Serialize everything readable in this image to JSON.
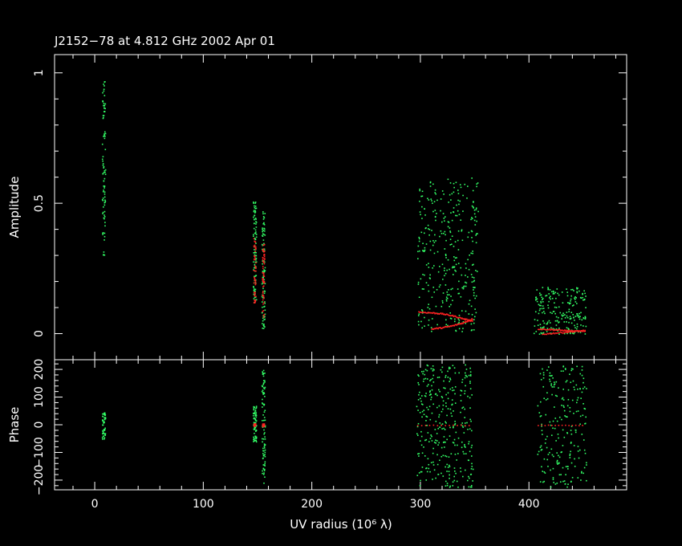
{
  "chart_data": [
    {
      "panel": "amplitude",
      "type": "scatter",
      "title": "J2152−78 at 4.812 GHz 2002 Apr 01",
      "ylabel": "Amplitude",
      "xlabel": "",
      "xlim": [
        -37,
        490
      ],
      "ylim": [
        -0.1,
        1.07
      ],
      "x_ticks": [
        0,
        100,
        200,
        300,
        400
      ],
      "y_ticks": [
        0,
        0.5,
        1
      ],
      "y_tick_labels": [
        "0",
        "0.5",
        "1"
      ],
      "series": [
        {
          "role": "data",
          "color": "#33ff66",
          "clusters": [
            {
              "x_center": 8,
              "x_width": 3,
              "y_min": 0.3,
              "y_max": 0.97,
              "count": 90
            },
            {
              "x_center": 147,
              "x_width": 3,
              "y_min": 0.12,
              "y_max": 0.51,
              "count": 90
            },
            {
              "x_center": 155,
              "x_width": 3,
              "y_min": 0.02,
              "y_max": 0.48,
              "count": 90
            },
            {
              "x_center": 325,
              "x_width": 56,
              "y_min": 0.01,
              "y_max": 0.6,
              "count": 340
            },
            {
              "x_center": 428,
              "x_width": 48,
              "y_min": 0.0,
              "y_max": 0.18,
              "count": 220
            }
          ]
        },
        {
          "role": "model",
          "color": "#ff2222",
          "clusters": [
            {
              "x_center": 147,
              "x_width": 2,
              "y_min": 0.12,
              "y_max": 0.37,
              "count": 50
            },
            {
              "x_center": 155,
              "x_width": 2,
              "y_min": 0.06,
              "y_max": 0.36,
              "count": 60
            }
          ],
          "curves": [
            {
              "x": [
                298,
                310,
                320,
                330,
                340,
                348
              ],
              "y": [
                0.085,
                0.082,
                0.078,
                0.07,
                0.058,
                0.05
              ]
            },
            {
              "x": [
                310,
                320,
                330,
                340,
                348
              ],
              "y": [
                0.02,
                0.025,
                0.033,
                0.045,
                0.06
              ]
            },
            {
              "x": [
                408,
                420,
                430,
                440,
                452
              ],
              "y": [
                0.02,
                0.018,
                0.015,
                0.012,
                0.01
              ]
            },
            {
              "x": [
                412,
                425,
                440,
                452
              ],
              "y": [
                0.0,
                0.005,
                0.01,
                0.015
              ]
            }
          ]
        }
      ]
    },
    {
      "panel": "phase",
      "type": "scatter",
      "ylabel": "Phase",
      "xlabel": "UV radius  (10⁶ λ)",
      "xlim": [
        -37,
        490
      ],
      "ylim": [
        -235,
        235
      ],
      "x_ticks": [
        0,
        100,
        200,
        300,
        400
      ],
      "x_tick_labels": [
        "0",
        "100",
        "200",
        "300",
        "400"
      ],
      "y_ticks": [
        -200,
        -100,
        0,
        100,
        200
      ],
      "y_tick_labels": [
        "−200",
        "−100",
        "0",
        "100",
        "200"
      ],
      "series": [
        {
          "role": "data",
          "color": "#33ff66",
          "clusters": [
            {
              "x_center": 8,
              "x_width": 3,
              "y_min": -50,
              "y_max": 45,
              "count": 50
            },
            {
              "x_center": 147,
              "x_width": 3,
              "y_min": -60,
              "y_max": 70,
              "count": 70
            },
            {
              "x_center": 155,
              "x_width": 3,
              "y_min": -210,
              "y_max": 200,
              "count": 90
            },
            {
              "x_center": 322,
              "x_width": 52,
              "y_min": -225,
              "y_max": 220,
              "count": 330
            },
            {
              "x_center": 430,
              "x_width": 45,
              "y_min": -225,
              "y_max": 215,
              "count": 220
            }
          ]
        },
        {
          "role": "model",
          "color": "#ff2222",
          "clusters": [
            {
              "x_center": 147,
              "x_width": 2,
              "y_min": -6,
              "y_max": 6,
              "count": 18
            },
            {
              "x_center": 155,
              "x_width": 2,
              "y_min": -6,
              "y_max": 6,
              "count": 18
            }
          ],
          "curves": [
            {
              "x": [
                297,
                348
              ],
              "y": [
                0,
                0
              ]
            },
            {
              "x": [
                408,
                452
              ],
              "y": [
                0,
                0
              ]
            }
          ]
        }
      ]
    }
  ]
}
